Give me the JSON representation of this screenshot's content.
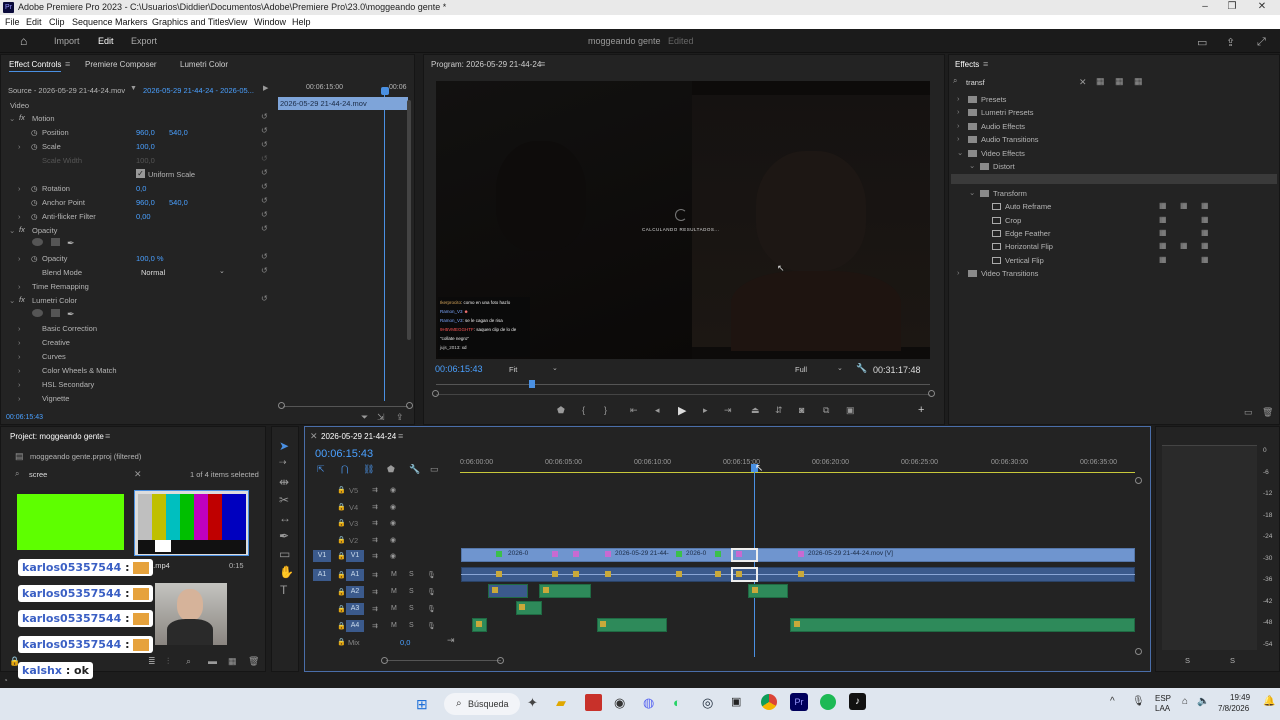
{
  "window": {
    "title": "Adobe Premiere Pro 2023 - C:\\Usuarios\\Diddier\\Documentos\\Adobe\\Premiere Pro\\23.0\\moggeando gente *"
  },
  "menu": [
    "File",
    "Edit",
    "Clip",
    "Sequence",
    "Markers",
    "Graphics and Titles",
    "View",
    "Window",
    "Help"
  ],
  "header": {
    "import": "Import",
    "edit": "Edit",
    "export": "Export",
    "project_name": "moggeando gente",
    "status": "Edited"
  },
  "effect_controls": {
    "tabs": [
      "Effect Controls",
      "Premiere Composer",
      "Lumetri Color"
    ],
    "source": "Source - 2026-05-29 21-44-24.mov",
    "sequence": "2026-05-29 21-44-24 - 2026-05...",
    "ruler_time": "00:06:15:00",
    "ruler_time2": "00:06",
    "clip_name": "2026-05-29 21-44-24.mov",
    "video_label": "Video",
    "motion": "Motion",
    "position": "Position",
    "position_x": "960,0",
    "position_y": "540,0",
    "scale": "Scale",
    "scale_val": "100,0",
    "scale_width": "Scale Width",
    "scale_width_val": "100,0",
    "uniform_scale": "Uniform Scale",
    "rotation": "Rotation",
    "rotation_val": "0,0",
    "anchor": "Anchor Point",
    "anchor_x": "960,0",
    "anchor_y": "540,0",
    "antiflicker": "Anti-flicker Filter",
    "antiflicker_val": "0,00",
    "opacity_group": "Opacity",
    "opacity": "Opacity",
    "opacity_val": "100,0 %",
    "blend_mode": "Blend Mode",
    "blend_val": "Normal",
    "time_remap": "Time Remapping",
    "lumetri": "Lumetri Color",
    "lumetri_items": [
      "Basic Correction",
      "Creative",
      "Curves",
      "Color Wheels & Match",
      "HSL Secondary",
      "Vignette"
    ],
    "timecode": "00:06:15:43"
  },
  "program": {
    "title": "Program: 2026-05-29 21-44-24",
    "calc_text": "CALCULANDO RESULTADOS...",
    "timecode": "00:06:15:43",
    "fit": "Fit",
    "quality": "Full",
    "duration": "00:31:17:48",
    "chat_lines": [
      {
        "user": "Ikerprocito",
        "msg": ": como en una foto hazlo"
      },
      {
        "user": "Ramon_V3",
        "msg": ""
      },
      {
        "user": "Ramon_V3",
        "msg": ": se le cagan de risa"
      },
      {
        "user": "9H5VMEGGHTF",
        "msg": ": saquen clip de lo de \"collate negro\""
      },
      {
        "user": "jujs_2013",
        "msg": ": xd"
      }
    ]
  },
  "effects": {
    "title": "Effects",
    "search": "transf",
    "tree": [
      {
        "label": "Presets",
        "level": 0
      },
      {
        "label": "Lumetri Presets",
        "level": 0
      },
      {
        "label": "Audio Effects",
        "level": 0
      },
      {
        "label": "Audio Transitions",
        "level": 0
      },
      {
        "label": "Video Effects",
        "level": 0
      },
      {
        "label": "Distort",
        "level": 1
      },
      {
        "label": "Transform",
        "level": 2
      },
      {
        "label": "Transform",
        "level": 1
      },
      {
        "label": "Auto Reframe",
        "level": 2
      },
      {
        "label": "Crop",
        "level": 2
      },
      {
        "label": "Edge Feather",
        "level": 2
      },
      {
        "label": "Horizontal Flip",
        "level": 2
      },
      {
        "label": "Vertical Flip",
        "level": 2
      },
      {
        "label": "Video Transitions",
        "level": 0
      }
    ]
  },
  "project": {
    "title": "Project: moggeando gente",
    "file": "moggeando gente.prproj (filtered)",
    "search": "scree",
    "selected": "1 of 4 items selected",
    "item_suffix": "n.mp4",
    "item_dur": "0:15"
  },
  "overlay_chat": [
    {
      "user": "karlos05357544",
      "msg": ":"
    },
    {
      "user": "karlos05357544",
      "msg": ":"
    },
    {
      "user": "karlos05357544",
      "msg": ":"
    },
    {
      "user": "karlos05357544",
      "msg": ":"
    },
    {
      "user": "kalshx",
      "msg": ": ok"
    }
  ],
  "timeline": {
    "tab": "2026-05-29 21-44-24",
    "timecode": "00:06:15:43",
    "ruler": [
      "0:06:00:00",
      "00:06:05:00",
      "00:06:10:00",
      "00:06:15:00",
      "00:06:20:00",
      "00:06:25:00",
      "00:06:30:00",
      "00:06:35:00"
    ],
    "video_tracks": [
      "V5",
      "V4",
      "V3",
      "V2",
      "V1"
    ],
    "audio_tracks": [
      "A1",
      "A2",
      "A3",
      "A4"
    ],
    "mix": "Mix",
    "mix_val": "0,0",
    "clip_labels": [
      "2026-0",
      "2026-05-29 21-44-",
      "2026-0",
      "2026-05-29 21-44-24.mov [V]"
    ]
  },
  "meter": {
    "labels": [
      "0",
      "-6",
      "-12",
      "-18",
      "-24",
      "-30",
      "-36",
      "-42",
      "-48",
      "-54"
    ],
    "solo": [
      "S",
      "S"
    ]
  },
  "taskbar": {
    "search": "Búsqueda",
    "lang1": "ESP",
    "lang2": "LAA",
    "time": "19:49",
    "date": "7/8/2026"
  }
}
